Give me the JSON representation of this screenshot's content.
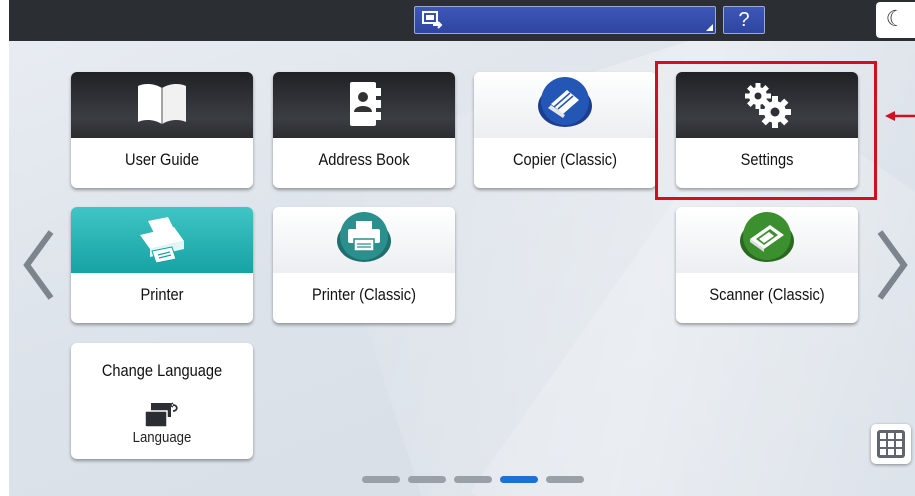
{
  "topbar": {
    "help_label": "?",
    "night_mode_glyph": "☾"
  },
  "tiles": {
    "user_guide": {
      "label": "User Guide",
      "icon": "book-icon"
    },
    "address_book": {
      "label": "Address Book",
      "icon": "address-book-icon"
    },
    "copier_classic": {
      "label": "Copier (Classic)",
      "icon": "copier-icon"
    },
    "settings": {
      "label": "Settings",
      "icon": "gears-icon"
    },
    "printer": {
      "label": "Printer",
      "icon": "printer-icon"
    },
    "printer_classic": {
      "label": "Printer (Classic)",
      "icon": "printer-icon"
    },
    "scanner_classic": {
      "label": "Scanner (Classic)",
      "icon": "scanner-icon"
    },
    "change_language": {
      "label": "Change Language",
      "sub_label": "Language",
      "icon": "language-icon"
    }
  },
  "pagination": {
    "pages": 5,
    "current": 4
  },
  "colors": {
    "highlight": "#d01020",
    "accent_blue": "#2e46a0",
    "active_page": "#1f6fd6",
    "teal": "#17a2a4",
    "copier_blue": "#2456b6",
    "scanner_green": "#3c8f2e",
    "printer_teal": "#2b8f8e"
  }
}
